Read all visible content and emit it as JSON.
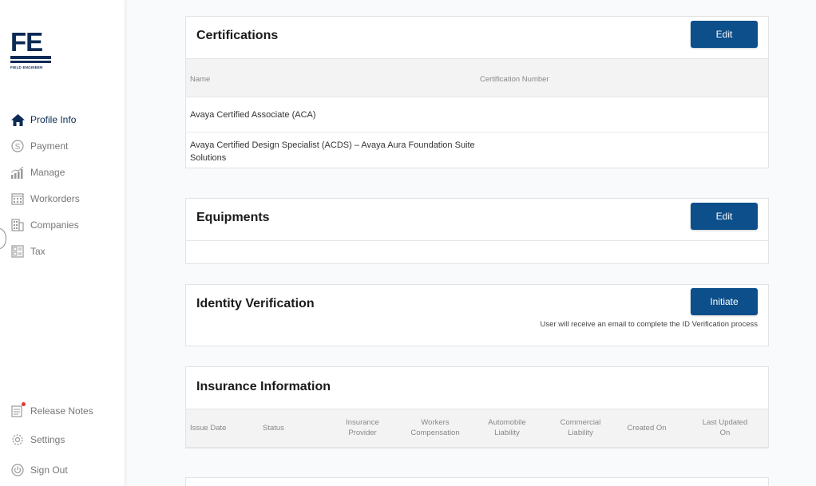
{
  "sidebar": {
    "logo": {
      "mark": "FE",
      "subtitle": "FIELD ENGINEER"
    },
    "items": [
      {
        "label": "Profile Info",
        "icon": "home-icon"
      },
      {
        "label": "Payment",
        "icon": "dollar-circle-icon"
      },
      {
        "label": "Manage",
        "icon": "bar-chart-icon"
      },
      {
        "label": "Workorders",
        "icon": "calendar-icon"
      },
      {
        "label": "Companies",
        "icon": "building-icon"
      },
      {
        "label": "Tax",
        "icon": "tax-form-icon"
      }
    ],
    "bottom_items": [
      {
        "label": "Release Notes",
        "icon": "release-notes-icon"
      },
      {
        "label": "Settings",
        "icon": "gear-icon"
      },
      {
        "label": "Sign Out",
        "icon": "power-icon"
      }
    ]
  },
  "certifications": {
    "title": "Certifications",
    "edit_label": "Edit",
    "columns": [
      "Name",
      "Certification Number"
    ],
    "rows": [
      {
        "name": "Avaya Certified Associate (ACA)",
        "number": ""
      },
      {
        "name": "Avaya Certified Design Specialist (ACDS) – Avaya Aura Foundation Suite Solutions",
        "number": ""
      }
    ]
  },
  "equipments": {
    "title": "Equipments",
    "edit_label": "Edit"
  },
  "identity": {
    "title": "Identity Verification",
    "button_label": "Initiate",
    "note": "User will receive an email to complete the ID Verification process"
  },
  "insurance": {
    "title": "Insurance Information",
    "columns": [
      "Issue Date",
      "Status",
      "Insurance Provider",
      "Workers Compensation",
      "Automobile Liability",
      "Commercial Liability",
      "Created On",
      "Last Updated On"
    ]
  },
  "colors": {
    "brand": "#0b2a55",
    "button": "#0c4f8b"
  }
}
